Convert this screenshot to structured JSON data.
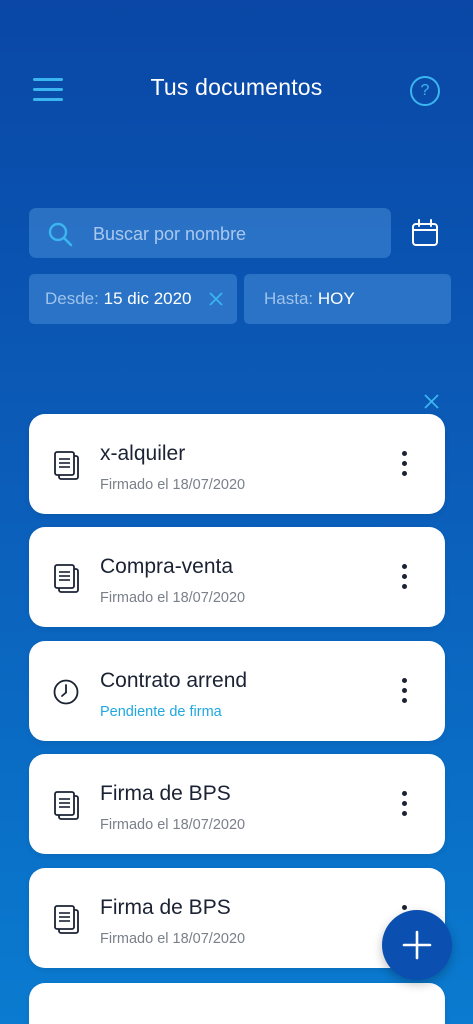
{
  "header": {
    "title": "Tus documentos",
    "menu_icon": "hamburger-menu-icon",
    "help_icon": "help-icon",
    "help_glyph": "?"
  },
  "search": {
    "placeholder": "Buscar por nombre",
    "value": ""
  },
  "filters": {
    "from_label": "Desde:",
    "from_value": "15 dic 2020",
    "to_label": "Hasta:",
    "to_value": "HOY"
  },
  "documents": [
    {
      "title": "x-alquiler",
      "status": "Firmado el 18/07/2020",
      "icon": "document-icon"
    },
    {
      "title": "Compra-venta",
      "status": "Firmado el 18/07/2020",
      "icon": "document-icon"
    },
    {
      "title": "Contrato arrend",
      "status": "Pendiente de firma",
      "icon": "clock-icon"
    },
    {
      "title": "Firma de BPS",
      "status": "Firmado el 18/07/2020",
      "icon": "document-icon"
    },
    {
      "title": "Firma de BPS",
      "status": "Firmado el 18/07/2020",
      "icon": "document-icon"
    }
  ],
  "colors": {
    "accent": "#3bb5f0",
    "pending": "#1fa8e0",
    "background_top": "#0a47a6",
    "background_bottom": "#0a7bd0",
    "fab": "#0b4fb0"
  }
}
